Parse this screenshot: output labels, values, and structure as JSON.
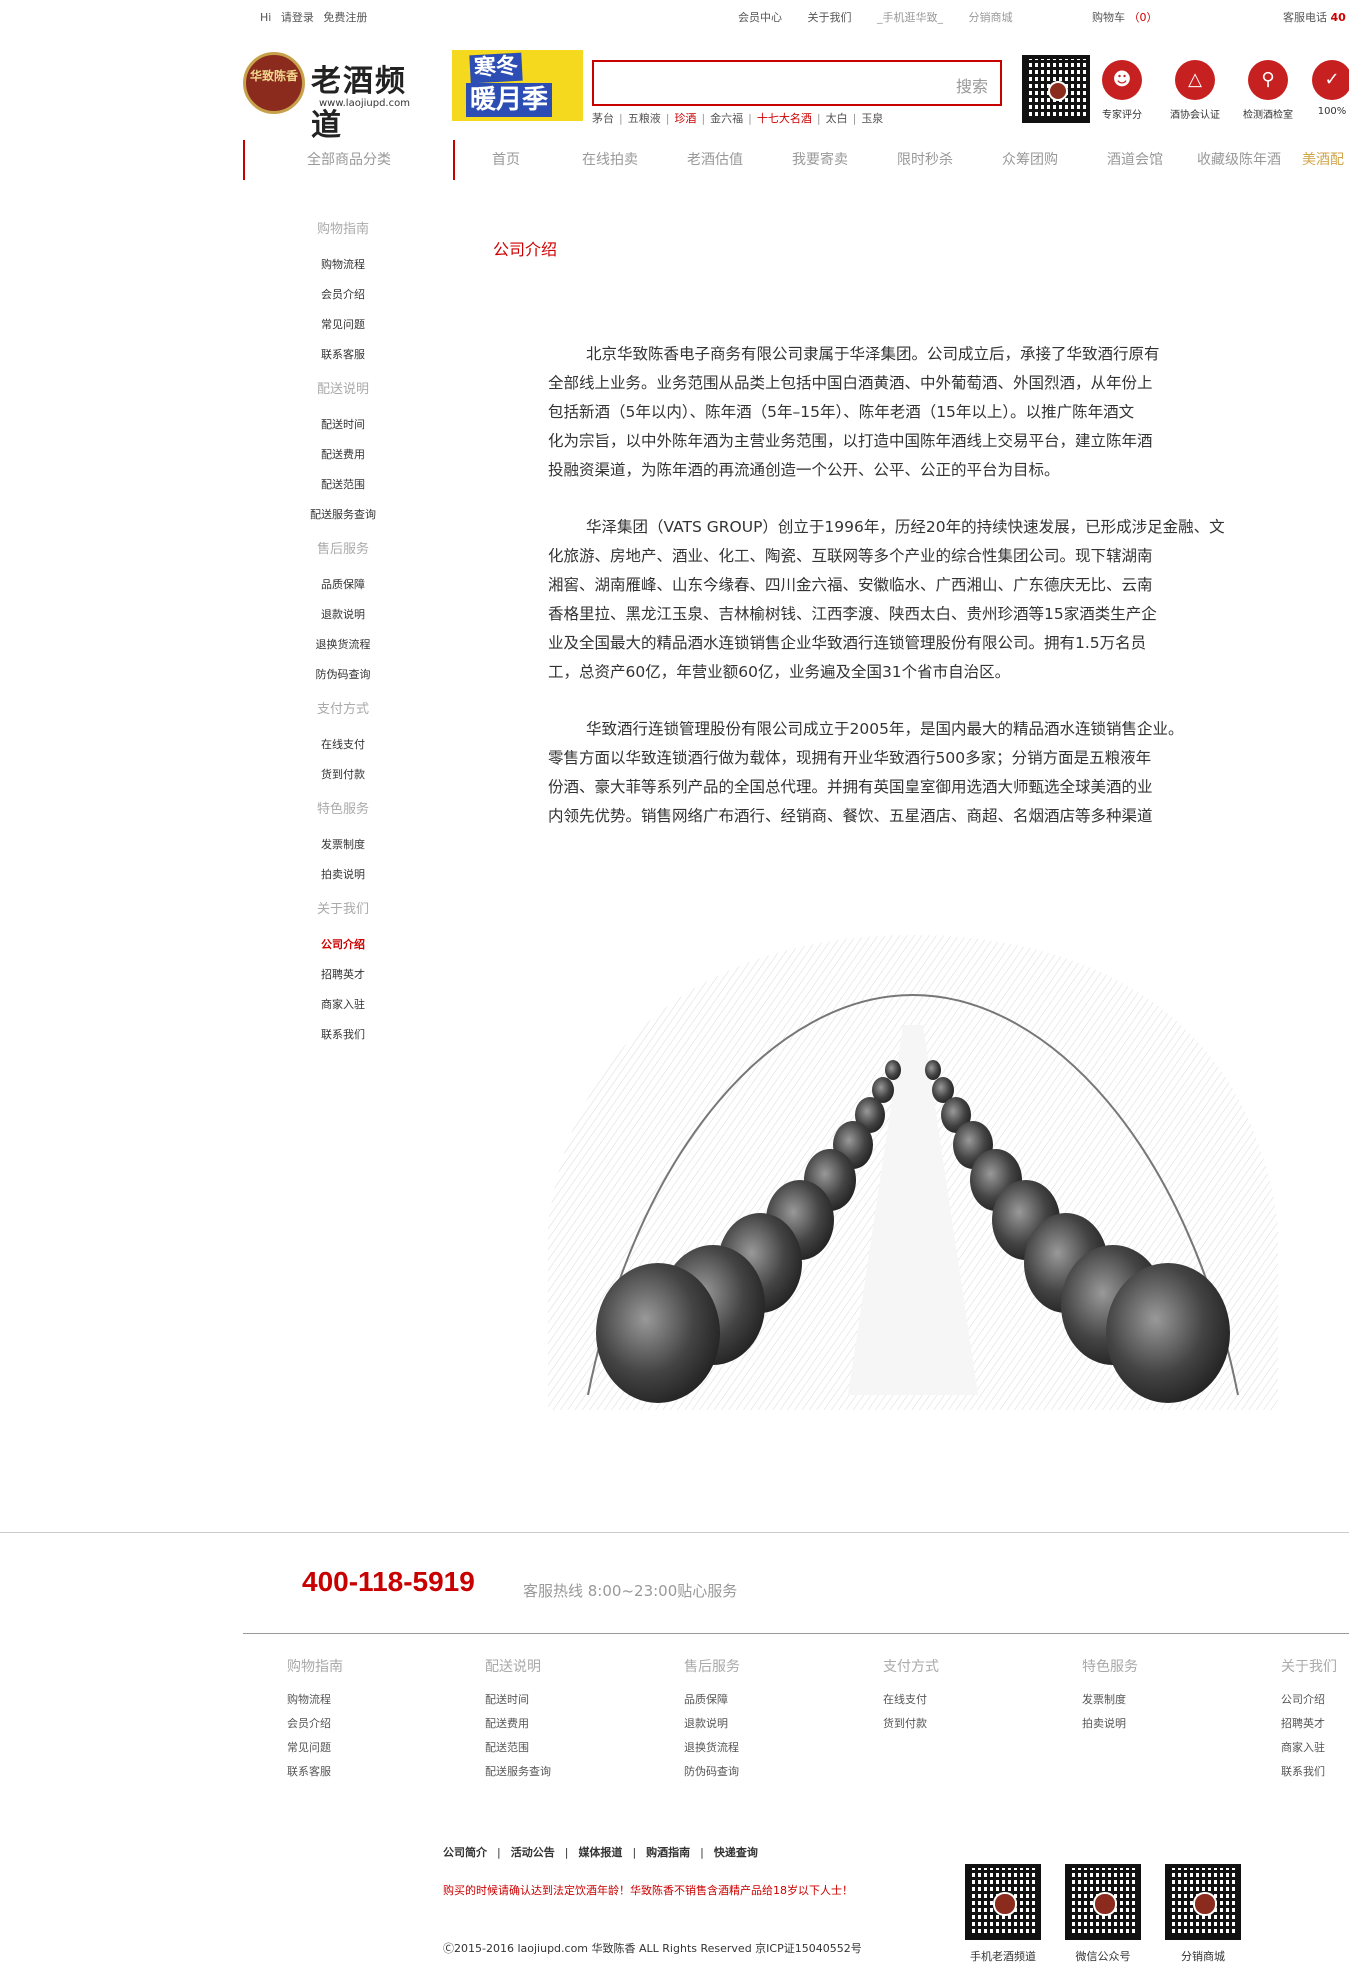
{
  "topbar": {
    "hi": "Hi",
    "login": "请登录",
    "register": "免费注册",
    "member_center": "会员中心",
    "about_us": "关于我们",
    "mobile": "_手机逛华致_",
    "distribution": "分销商城",
    "cart_label": "购物车",
    "cart_count": "（0）",
    "service_label": "客服电话",
    "service_number": "40"
  },
  "header": {
    "logo_seal": "华致陈香",
    "logo_name": "老酒频道",
    "logo_url": "www.laojiupd.com",
    "promo_line1": "寒冬",
    "promo_line2": "暖月季",
    "search_button": "搜索",
    "search_placeholder": "",
    "hotwords": [
      "茅台",
      "五粮液",
      "珍酒",
      "金六福",
      "十七大名酒",
      "太白",
      "玉泉"
    ],
    "features": [
      "专家评分",
      "酒协会认证",
      "检测酒检室",
      "100%"
    ]
  },
  "nav": {
    "all_categories": "全部商品分类",
    "items": [
      "首页",
      "在线拍卖",
      "老酒估值",
      "我要寄卖",
      "限时秒杀",
      "众筹团购",
      "酒道会馆",
      "收藏级陈年酒",
      "美酒配"
    ]
  },
  "sidebar": {
    "groups": [
      {
        "title": "购物指南",
        "items": [
          "购物流程",
          "会员介绍",
          "常见问题",
          "联系客服"
        ]
      },
      {
        "title": "配送说明",
        "items": [
          "配送时间",
          "配送费用",
          "配送范围",
          "配送服务查询"
        ]
      },
      {
        "title": "售后服务",
        "items": [
          "品质保障",
          "退款说明",
          "退换货流程",
          "防伪码查询"
        ]
      },
      {
        "title": "支付方式",
        "items": [
          "在线支付",
          "货到付款"
        ]
      },
      {
        "title": "特色服务",
        "items": [
          "发票制度",
          "拍卖说明"
        ]
      },
      {
        "title": "关于我们",
        "items": [
          "公司介绍",
          "招聘英才",
          "商家入驻",
          "联系我们"
        ]
      }
    ],
    "active": "公司介绍"
  },
  "content": {
    "title": "公司介绍",
    "paragraphs": [
      [
        "北京华致陈香电子商务有限公司隶属于华泽集团。公司成立后，承接了华致酒行原有",
        "全部线上业务。业务范围从品类上包括中国白酒黄酒、中外葡萄酒、外国烈酒，从年份上",
        "包括新酒（5年以内）、陈年酒（5年–15年）、陈年老酒（15年以上）。以推广陈年酒文",
        "化为宗旨，以中外陈年酒为主营业务范围，以打造中国陈年酒线上交易平台，建立陈年酒",
        "投融资渠道，为陈年酒的再流通创造一个公开、公平、公正的平台为目标。"
      ],
      [
        "华泽集团（VATS GROUP）创立于1996年，历经20年的持续快速发展，已形成涉足金融、文",
        "化旅游、房地产、酒业、化工、陶瓷、互联网等多个产业的综合性集团公司。现下辖湖南",
        "湘窖、湖南雁峰、山东今缘春、四川金六福、安徽临水、广西湘山、广东德庆无比、云南",
        "香格里拉、黑龙江玉泉、吉林榆树钱、江西李渡、陕西太白、贵州珍酒等15家酒类生产企",
        "业及全国最大的精品酒水连锁销售企业华致酒行连锁管理股份有限公司。拥有1.5万名员",
        "工，总资产60亿，年营业额60亿，业务遍及全国31个省市自治区。"
      ],
      [
        "华致酒行连锁管理股份有限公司成立于2005年，是国内最大的精品酒水连锁销售企业。",
        "零售方面以华致连锁酒行做为载体，现拥有开业华致酒行500多家；分销方面是五粮液年",
        "份酒、豪大菲等系列产品的全国总代理。并拥有英国皇室御用选酒大师甄选全球美酒的业",
        "内领先优势。销售网络广布酒行、经销商、餐饮、五星酒店、商超、名烟酒店等多种渠道"
      ]
    ]
  },
  "footer": {
    "hotline": "400-118-5919",
    "hotline_desc": "客服热线  8:00~23:00贴心服务",
    "columns": [
      {
        "title": "购物指南",
        "items": [
          "购物流程",
          "会员介绍",
          "常见问题",
          "联系客服"
        ]
      },
      {
        "title": "配送说明",
        "items": [
          "配送时间",
          "配送费用",
          "配送范围",
          "配送服务查询"
        ]
      },
      {
        "title": "售后服务",
        "items": [
          "品质保障",
          "退款说明",
          "退换货流程",
          "防伪码查询"
        ]
      },
      {
        "title": "支付方式",
        "items": [
          "在线支付",
          "货到付款"
        ]
      },
      {
        "title": "特色服务",
        "items": [
          "发票制度",
          "拍卖说明"
        ]
      },
      {
        "title": "关于我们",
        "items": [
          "公司介绍",
          "招聘英才",
          "商家入驻",
          "联系我们"
        ]
      }
    ],
    "links": [
      "公司简介",
      "活动公告",
      "媒体报道",
      "购酒指南",
      "快递查询"
    ],
    "notice": "购买的时候请确认达到法定饮酒年龄！华致陈香不销售含酒精产品给18岁以下人士！",
    "copyright": "Ⓒ2015-2016 laojiupd.com 华致陈香 ALL Rights Reserved 京ICP证15040552号",
    "qr_labels": [
      "手机老酒频道",
      "微信公众号",
      "分销商城"
    ]
  },
  "colors": {
    "brand_red": "#c80000",
    "gold": "#d0a64a"
  }
}
